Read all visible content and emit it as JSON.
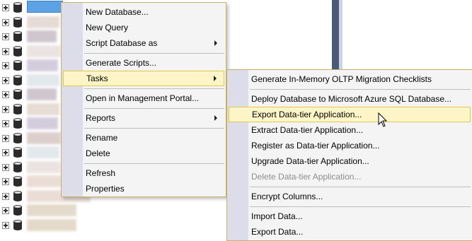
{
  "tree": {
    "rows": 16
  },
  "context_menu": {
    "items": [
      {
        "label": "New Database..."
      },
      {
        "label": "New Query"
      },
      {
        "label": "Script Database as"
      },
      {
        "label": "Generate Scripts..."
      },
      {
        "label": "Tasks"
      },
      {
        "label": "Open in Management Portal..."
      },
      {
        "label": "Reports"
      },
      {
        "label": "Rename"
      },
      {
        "label": "Delete"
      },
      {
        "label": "Refresh"
      },
      {
        "label": "Properties"
      }
    ]
  },
  "tasks_submenu": {
    "items": [
      {
        "label": "Generate In-Memory OLTP Migration Checklists"
      },
      {
        "label": "Deploy Database to Microsoft Azure SQL Database..."
      },
      {
        "label": "Export Data-tier Application..."
      },
      {
        "label": "Extract Data-tier Application..."
      },
      {
        "label": "Register as Data-tier Application..."
      },
      {
        "label": "Upgrade Data-tier Application..."
      },
      {
        "label": "Delete Data-tier Application..."
      },
      {
        "label": "Encrypt Columns..."
      },
      {
        "label": "Import Data..."
      },
      {
        "label": "Export Data..."
      }
    ]
  },
  "colors": {
    "highlight_bg": "#fdf5c7",
    "highlight_border": "#e3c74c",
    "menu_bg": "#f4f4f4",
    "gutter": "#dcdde9",
    "selection": "#5ea2e6"
  }
}
